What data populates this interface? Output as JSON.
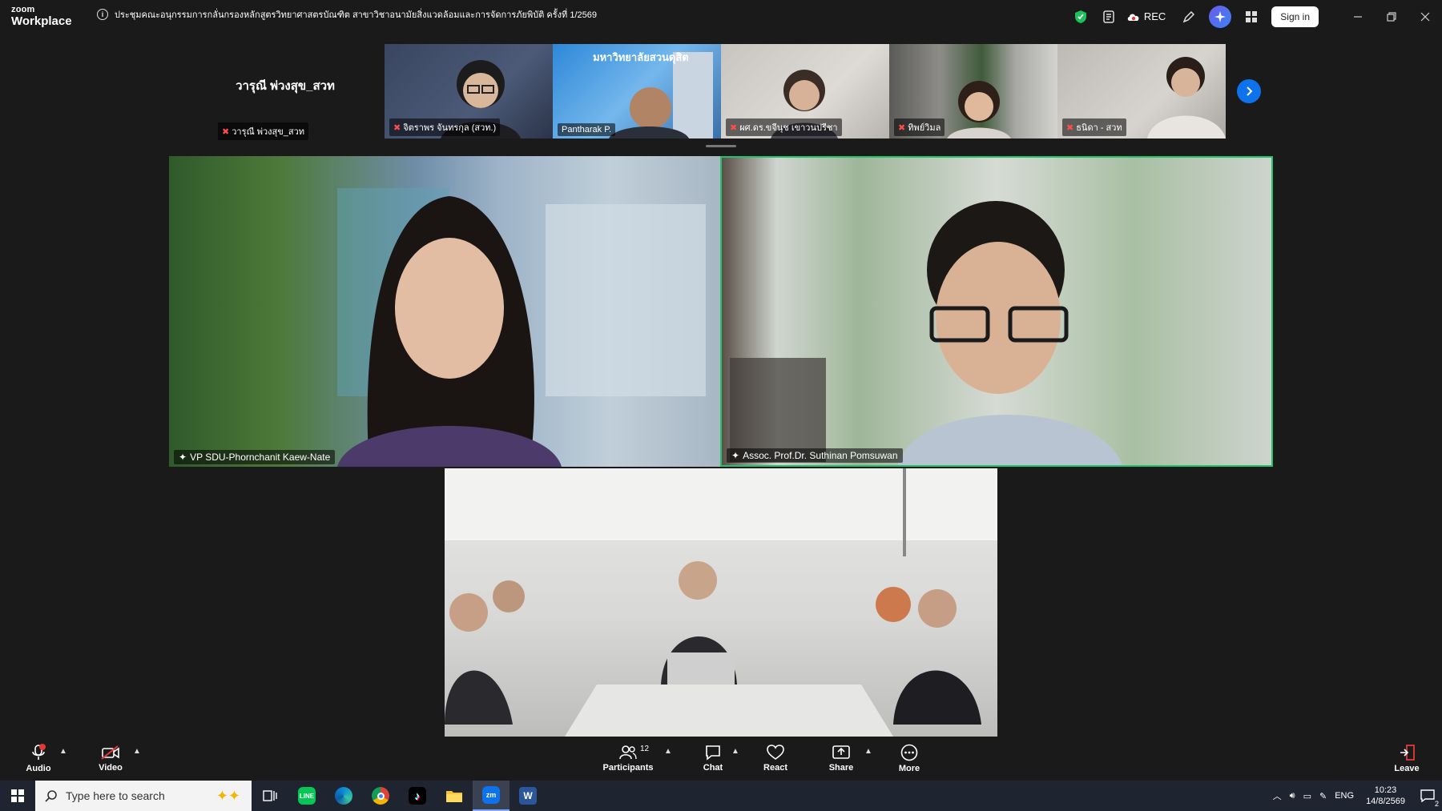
{
  "app": {
    "brand_top": "zoom",
    "brand_bottom": "Workplace",
    "meeting_title": "ประชุมคณะอนุกรรมการกลั่นกรองหลักสูตรวิทยาศาสตรบัณฑิต สาขาวิชาอนามัยสิ่งแวดล้อมและการจัดการภัยพิบัติ ครั้งที่ 1/2569",
    "rec_label": "REC",
    "signin_label": "Sign in"
  },
  "filmstrip": {
    "self_name_large": "วารุณี พ่วงสุข_สวท",
    "self_label": "วารุณี พ่วงสุข_สวท",
    "thumbs": [
      {
        "label": "จิตราพร จันทรกุล (สวท.)",
        "muted": true
      },
      {
        "label": "Pantharak P.",
        "muted": false
      },
      {
        "label": "ผศ.ดร.ขจีนุช เขาวนปรีชา",
        "muted": true
      },
      {
        "label": "ทิพย์วิมล",
        "muted": true
      },
      {
        "label": "ธนิดา - สวท",
        "muted": true
      }
    ],
    "thumb_bg_text": "มหาวิทยาลัยสวนดุสิต"
  },
  "videos": [
    {
      "name": "VP SDU-Phornchanit Kaew-Nate"
    },
    {
      "name": "Assoc. Prof.Dr. Suthinan Pomsuwan"
    },
    {
      "name": ""
    }
  ],
  "toolbar": {
    "audio_label": "Audio",
    "video_label": "Video",
    "participants_label": "Participants",
    "participants_count": "12",
    "chat_label": "Chat",
    "react_label": "React",
    "share_label": "Share",
    "more_label": "More",
    "leave_label": "Leave"
  },
  "taskbar": {
    "search_placeholder": "Type here to search",
    "lang": "ENG",
    "time": "10:23",
    "date": "14/8/2569",
    "notif_count": "2"
  },
  "colors": {
    "active_speaker_border": "#24c26b",
    "zoom_blue": "#0e72ed",
    "mute_red": "#ff4d4d"
  }
}
